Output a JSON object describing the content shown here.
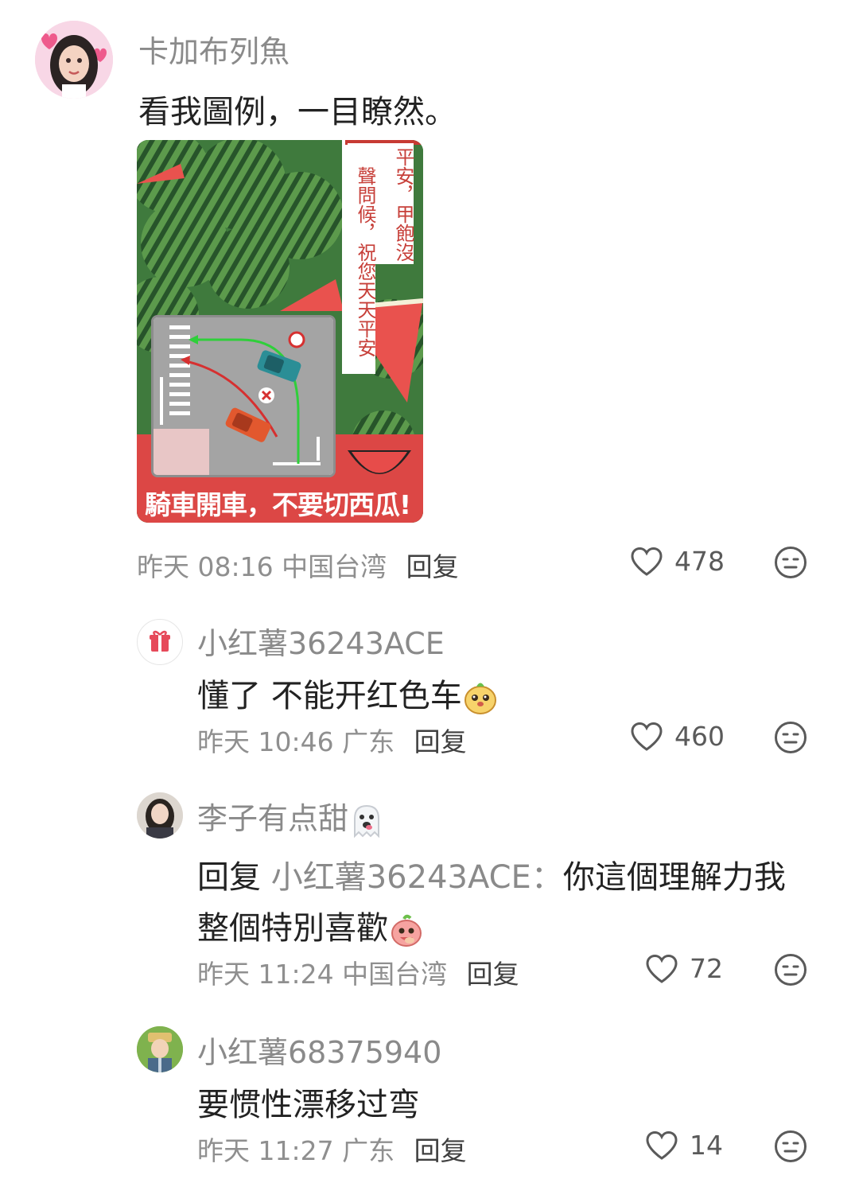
{
  "comments": [
    {
      "username": "卡加布列魚",
      "text": "看我圖例，一目瞭然。",
      "time": "昨天 08:16",
      "location": "中国台湾",
      "reply": "回复",
      "likes": "478",
      "image": {
        "vertical_text_1": "平安，甲飽沒",
        "vertical_text_2": "聲問候，祝您天天平安",
        "caption": "騎車開車，不要切西瓜!"
      }
    },
    {
      "username": "小红薯36243ACE",
      "text": "懂了 不能开红色车",
      "time": "昨天 10:46",
      "location": "广东",
      "reply": "回复",
      "likes": "460"
    },
    {
      "username": "李子有点甜",
      "reply_prefix": "回复",
      "reply_to": "小红薯36243ACE：",
      "text_line1": "你這個理解力我",
      "text_line2": "整個特別喜歡",
      "time": "昨天 11:24",
      "location": "中国台湾",
      "reply": "回复",
      "likes": "72"
    },
    {
      "username": "小红薯68375940",
      "text": "要惯性漂移过弯",
      "time": "昨天 11:27",
      "location": "广东",
      "reply": "回复",
      "likes": "14"
    }
  ],
  "icons": {
    "like": "heart-outline-icon",
    "dislike": "meh-face-icon"
  },
  "colors": {
    "username": "#8a8a8a",
    "text": "#222222",
    "meta": "#8f8f8f"
  }
}
